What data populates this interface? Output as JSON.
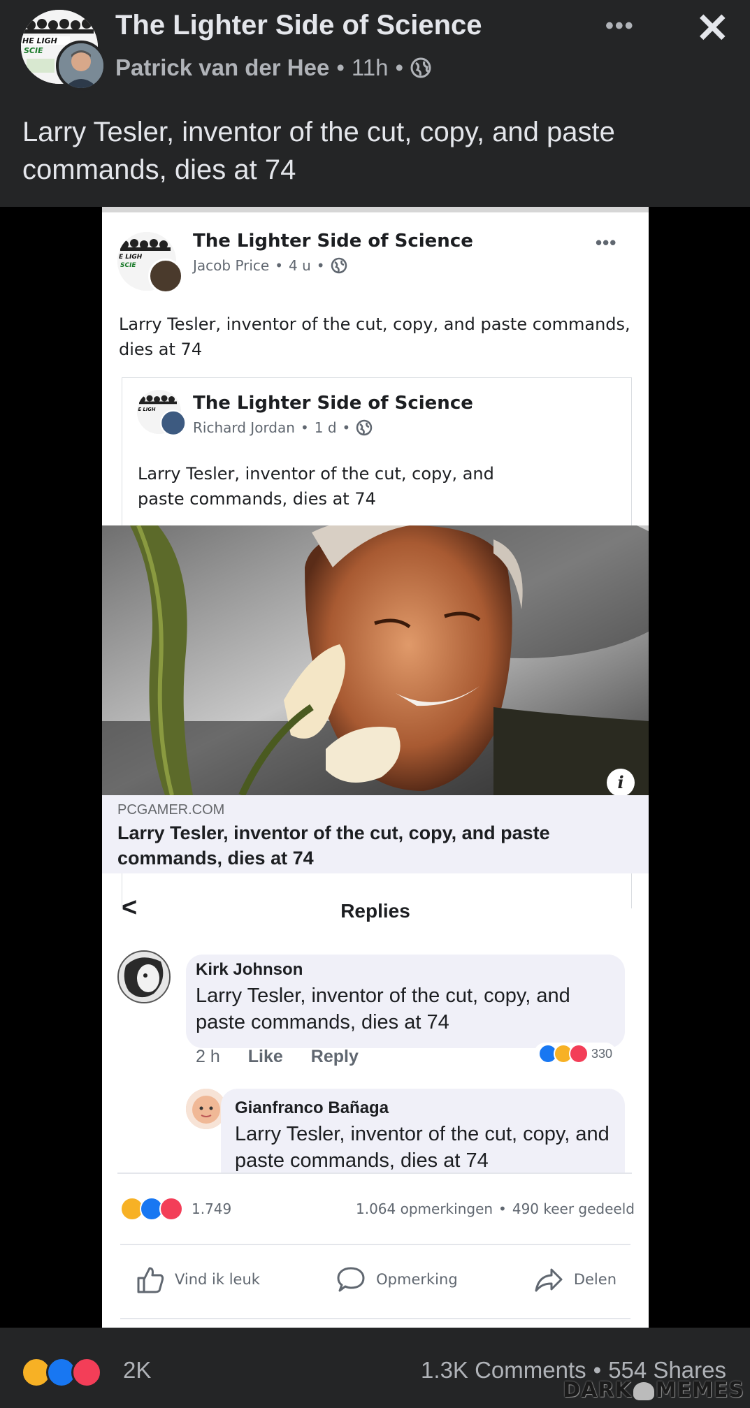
{
  "outer_post": {
    "page_name": "The Lighter Side of Science",
    "author": "Patrick van der Hee",
    "time": "11h",
    "separator": "•",
    "text": "Larry Tesler, inventor of the cut, copy, and paste commands, dies at 74",
    "avatar_logo_text": "HE LIGH SCIE"
  },
  "inner_post": {
    "page_name": "The Lighter Side of Science",
    "author": "Jacob Price",
    "time": "4 u",
    "separator": "•",
    "text": "Larry Tesler, inventor of the cut, copy, and paste commands, dies at 74"
  },
  "shared_post": {
    "page_name": "The Lighter Side of Science",
    "author": "Richard Jordan",
    "time": "1 d",
    "separator": "•",
    "text": "Larry Tesler, inventor of the cut, copy, and paste commands, dies at 74"
  },
  "link": {
    "domain": "PCGAMER.COM",
    "title": "Larry Tesler, inventor of the cut, copy, and paste commands, dies at 74",
    "info_glyph": "i"
  },
  "replies": {
    "title": "Replies",
    "back_glyph": "<",
    "comments": [
      {
        "name": "Kirk Johnson",
        "text": "Larry Tesler, inventor of the cut, copy, and paste commands, dies at 74",
        "time": "2 h",
        "like_label": "Like",
        "reply_label": "Reply",
        "reaction_count": "330"
      },
      {
        "name": "Gianfranco Bañaga",
        "text": "Larry Tesler, inventor of the cut, copy, and paste commands, dies at 74"
      }
    ]
  },
  "inner_stats": {
    "reactions": "1.749",
    "comments": "1.064 opmerkingen",
    "shares": "490 keer gedeeld",
    "separator": "•"
  },
  "inner_actions": {
    "like": "Vind ik leuk",
    "comment": "Opmerking",
    "share": "Delen"
  },
  "outer_stats": {
    "reactions": "2K",
    "comments": "1.3K Comments",
    "shares": "554 Shares",
    "separator": "•"
  },
  "watermark": {
    "left": "DARK",
    "right": "MEMES"
  },
  "colors": {
    "dark_bg": "#242526",
    "like_blue": "#1877f2",
    "love_red": "#f33e58",
    "haha_yellow": "#f7b125"
  }
}
